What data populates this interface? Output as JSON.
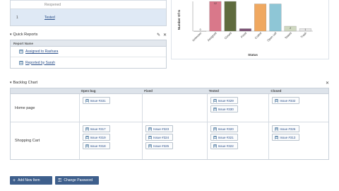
{
  "top_table": {
    "rows": [
      {
        "num": "",
        "status": "Reopened"
      },
      {
        "num": "1",
        "status": "Tested"
      }
    ]
  },
  "chart_data": {
    "type": "bar",
    "xlabel": "Status",
    "ylabel": "Number Of Is",
    "ylim": [
      0,
      12
    ],
    "categories": [
      "Unknown",
      "Assigned",
      "Closed",
      "Fixed",
      "Coded",
      "Open call",
      "Tested",
      "Trash"
    ],
    "values": [
      0,
      12,
      12,
      1,
      11,
      11,
      2,
      1
    ],
    "data_labels": [
      "0",
      "12",
      "",
      "",
      "",
      "",
      "2",
      "1"
    ],
    "colors": [
      "#f0f0f0",
      "#d9788a",
      "#5f6b3e",
      "#7a4f73",
      "#f0a860",
      "#8ec6d6",
      "#cfd8c0",
      "#e6e6e6"
    ]
  },
  "quick_reports": {
    "title": "Quick Reports",
    "edit_icon": "pencil-icon",
    "close_icon": "close-icon",
    "header": "Report Name",
    "items": [
      "Assigned to Rashara",
      "Reported by Sarah"
    ]
  },
  "backlog": {
    "title": "Backlog Chart",
    "close_icon": "close-icon",
    "columns": [
      "",
      "Open bug",
      "Fixed",
      "Tested",
      "Closed"
    ],
    "rows": [
      {
        "label": "Home page",
        "cells": [
          [
            "Issue #331"
          ],
          [],
          [
            "Issue #329",
            "Issue #330"
          ],
          [
            "Issue #332"
          ]
        ]
      },
      {
        "label": "Shopping Cart",
        "cells": [
          [
            "Issue #317",
            "Issue #319",
            "Issue #318"
          ],
          [
            "Issue #323",
            "Issue #324",
            "Issue #325"
          ],
          [
            "Issue #320",
            "Issue #321",
            "Issue #322"
          ],
          [
            "Issue #326",
            "Issue #313"
          ]
        ]
      }
    ]
  },
  "buttons": {
    "add": "Add New Item",
    "add_icon": "plus-icon",
    "password": "Change Password",
    "password_icon": "key-icon"
  }
}
